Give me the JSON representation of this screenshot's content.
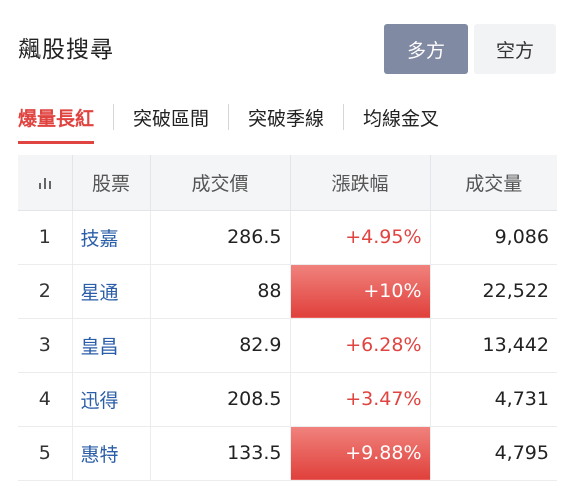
{
  "header": {
    "title": "飆股搜尋",
    "toggle": [
      {
        "label": "多方",
        "active": true
      },
      {
        "label": "空方",
        "active": false
      }
    ]
  },
  "tabs": [
    {
      "label": "爆量長紅",
      "active": true
    },
    {
      "label": "突破區間",
      "active": false
    },
    {
      "label": "突破季線",
      "active": false
    },
    {
      "label": "均線金叉",
      "active": false
    }
  ],
  "table": {
    "columns": {
      "rank_icon": "bar-chart-icon",
      "name": "股票",
      "price": "成交價",
      "change": "漲跌幅",
      "volume": "成交量"
    },
    "rows": [
      {
        "rank": "1",
        "name": "技嘉",
        "price": "286.5",
        "change": "+4.95%",
        "volume": "9,086",
        "limit_up": false
      },
      {
        "rank": "2",
        "name": "星通",
        "price": "88",
        "change": "+10%",
        "volume": "22,522",
        "limit_up": true
      },
      {
        "rank": "3",
        "name": "皇昌",
        "price": "82.9",
        "change": "+6.28%",
        "volume": "13,442",
        "limit_up": false
      },
      {
        "rank": "4",
        "name": "迅得",
        "price": "208.5",
        "change": "+3.47%",
        "volume": "4,731",
        "limit_up": false
      },
      {
        "rank": "5",
        "name": "惠特",
        "price": "133.5",
        "change": "+9.88%",
        "volume": "4,795",
        "limit_up": true
      }
    ]
  },
  "colors": {
    "accent_red": "#e04440",
    "link_blue": "#2b5ea8",
    "toggle_active": "#818aa3"
  }
}
